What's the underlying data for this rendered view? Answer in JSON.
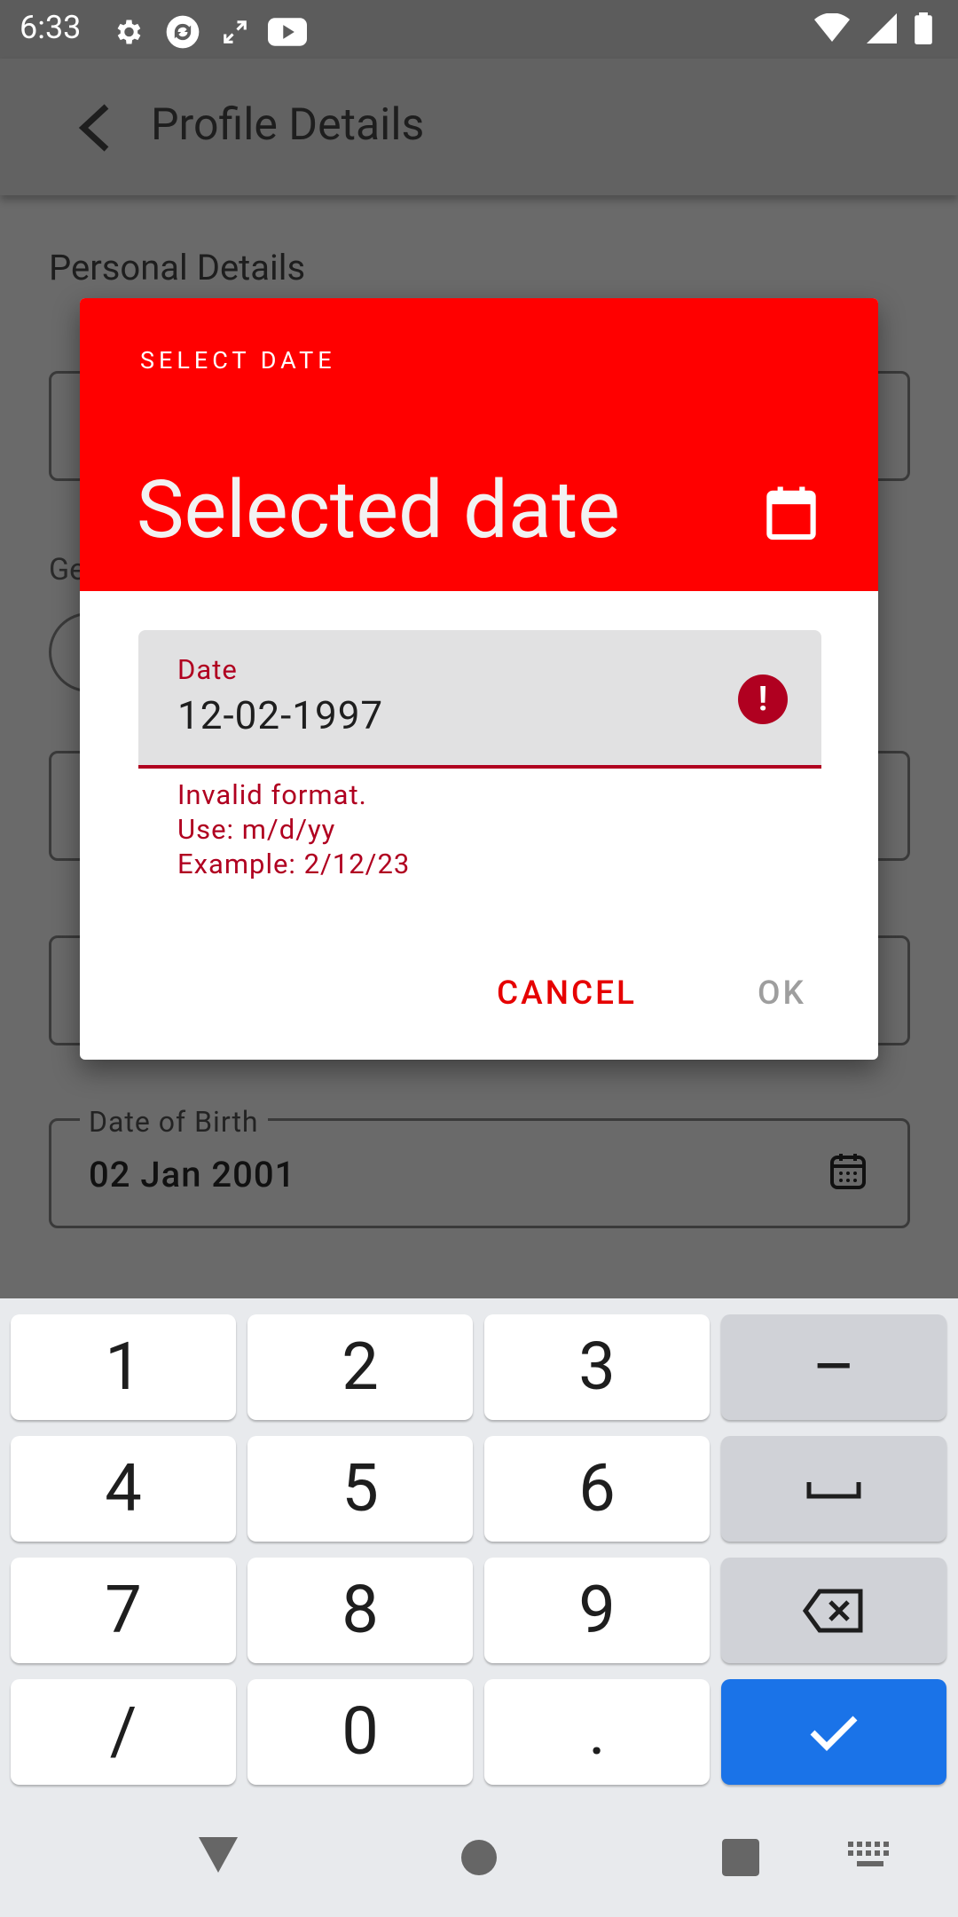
{
  "status_bar": {
    "time": "6:33",
    "icons": [
      "gear-icon",
      "sync-icon",
      "expand-icon",
      "youtube-icon"
    ],
    "right_icons": [
      "wifi-icon",
      "signal-icon",
      "battery-icon"
    ]
  },
  "app_bar": {
    "title": "Profile Details"
  },
  "background": {
    "section_title": "Personal Details",
    "gender_label": "Ge",
    "dob_label": "Date of Birth",
    "dob_value": "02 Jan 2001"
  },
  "dialog": {
    "caption": "SELECT DATE",
    "headline": "Selected date",
    "input": {
      "label": "Date",
      "value": "12-02-1997",
      "error_icon": "!"
    },
    "error_lines": [
      "Invalid format.",
      "Use: m/d/yy",
      "Example: 2/12/23"
    ],
    "cancel_label": "CANCEL",
    "ok_label": "OK",
    "accent_color": "#ff0000",
    "error_color": "#b00020"
  },
  "keyboard": {
    "keys": [
      "1",
      "2",
      "3",
      "–",
      "4",
      "5",
      "6",
      "␣",
      "7",
      "8",
      "9",
      "⌫",
      "/",
      "0",
      ".",
      "✓"
    ],
    "enter_color": "#1a73e8"
  }
}
